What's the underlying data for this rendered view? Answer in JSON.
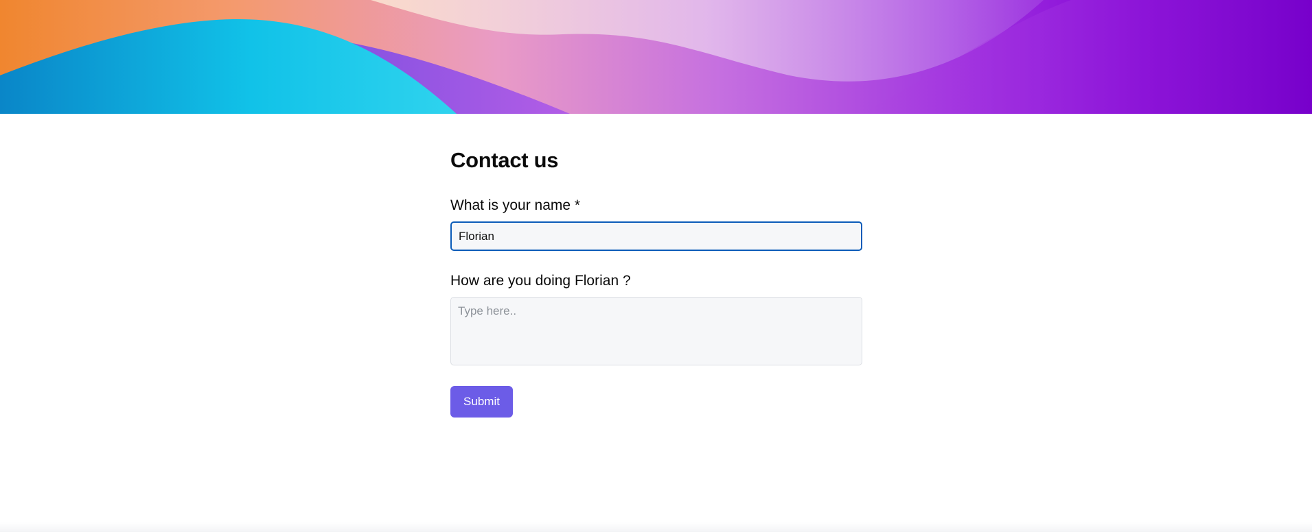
{
  "form": {
    "title": "Contact us",
    "name_label": "What is your name *",
    "name_value": "Florian",
    "feeling_label": "How are you doing Florian ?",
    "feeling_placeholder": "Type here..",
    "submit_label": "Submit"
  },
  "colors": {
    "accent": "#6c5ce7",
    "focus_border": "#0a5bb8",
    "input_background": "#f6f7f9"
  }
}
